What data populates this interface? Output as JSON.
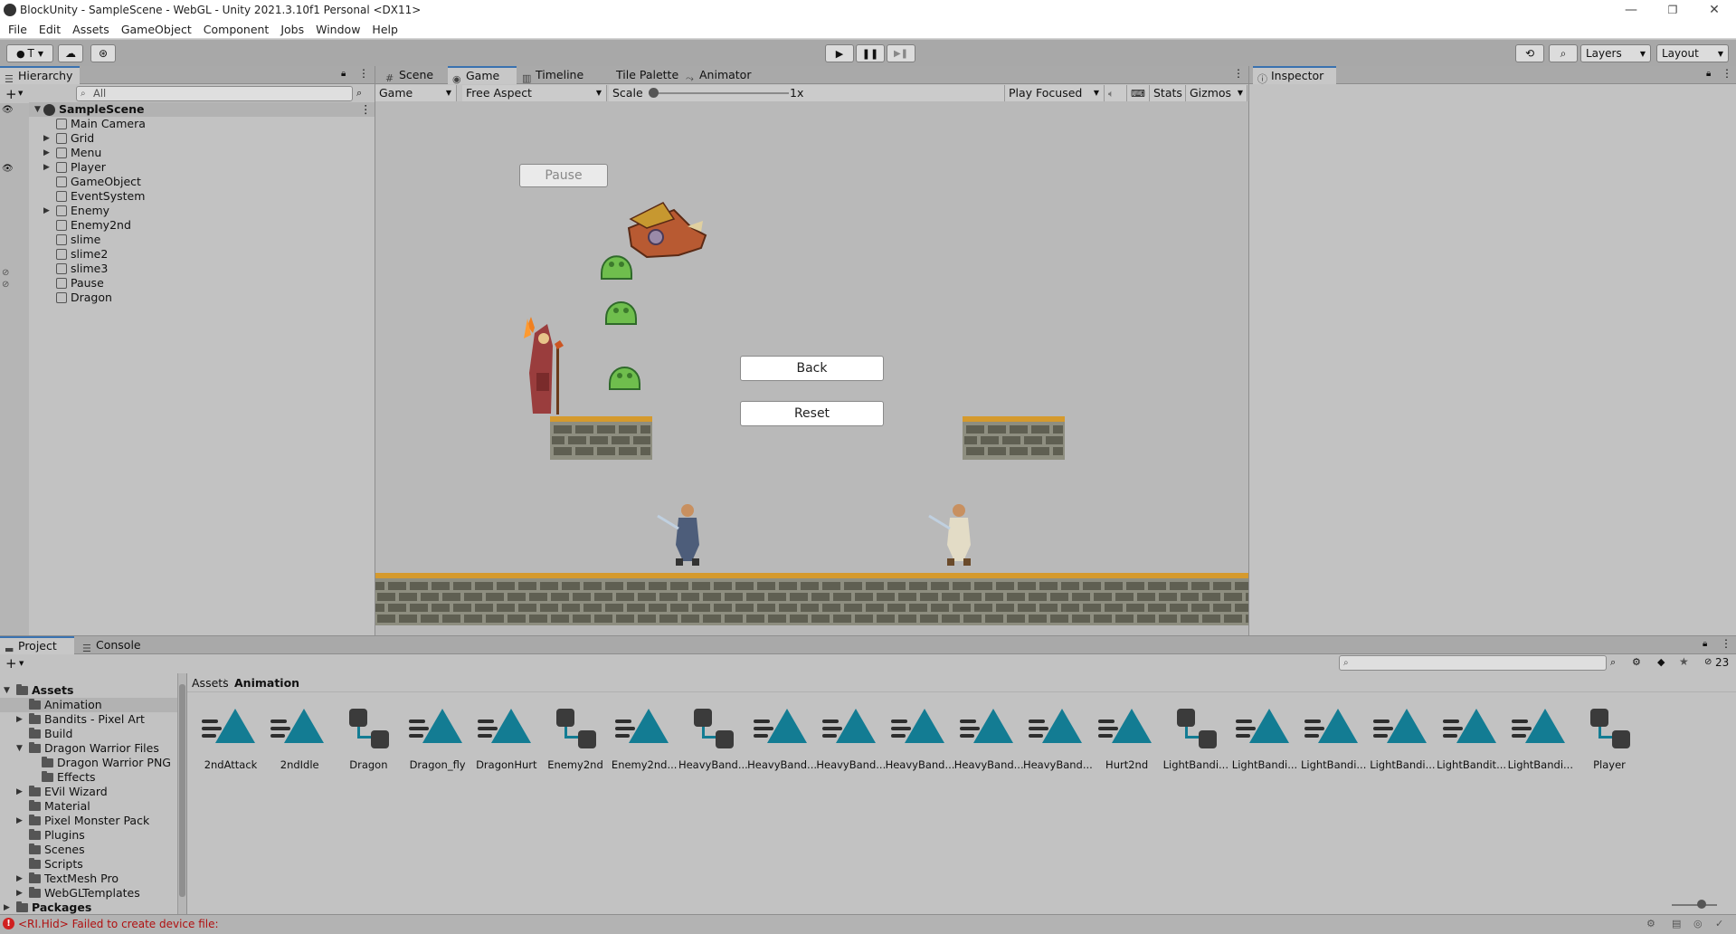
{
  "window": {
    "title": "BlockUnity - SampleScene - WebGL - Unity 2021.3.10f1 Personal <DX11>",
    "controls": [
      "—",
      "❐",
      "✕"
    ]
  },
  "menu": [
    "File",
    "Edit",
    "Assets",
    "GameObject",
    "Component",
    "Jobs",
    "Window",
    "Help"
  ],
  "toolbar": {
    "account_label": "T",
    "layers_label": "Layers",
    "layout_label": "Layout"
  },
  "hierarchy": {
    "tab_label": "Hierarchy",
    "search_placeholder": "All",
    "scene_name": "SampleScene",
    "items": [
      {
        "name": "Main Camera",
        "expandable": false
      },
      {
        "name": "Grid",
        "expandable": true
      },
      {
        "name": "Menu",
        "expandable": true
      },
      {
        "name": "Player",
        "expandable": true
      },
      {
        "name": "GameObject",
        "expandable": false
      },
      {
        "name": "EventSystem",
        "expandable": false
      },
      {
        "name": "Enemy",
        "expandable": true
      },
      {
        "name": "Enemy2nd",
        "expandable": false
      },
      {
        "name": "slime",
        "expandable": false
      },
      {
        "name": "slime2",
        "expandable": false
      },
      {
        "name": "slime3",
        "expandable": false
      },
      {
        "name": "Pause",
        "expandable": false
      },
      {
        "name": "Dragon",
        "expandable": false
      }
    ]
  },
  "center_tabs": [
    "Scene",
    "Game",
    "Timeline",
    "Tile Palette",
    "Animator"
  ],
  "game_toolbar": {
    "display": "Game",
    "aspect": "Free Aspect",
    "scale_label": "Scale",
    "scale_value": "1x",
    "play_mode": "Play Focused",
    "stats": "Stats",
    "gizmos": "Gizmos"
  },
  "game_view": {
    "pause_button": "Pause",
    "back_button": "Back",
    "reset_button": "Reset"
  },
  "inspector": {
    "tab_label": "Inspector"
  },
  "bottom_tabs": [
    "Project",
    "Console"
  ],
  "project": {
    "hidden_count": "23",
    "breadcrumb": [
      "Assets",
      "Animation"
    ],
    "tree": [
      {
        "name": "Assets",
        "level": 0,
        "expanded": true,
        "bold": true
      },
      {
        "name": "Animation",
        "level": 1,
        "selected": true
      },
      {
        "name": "Bandits - Pixel Art",
        "level": 1,
        "expandable": true
      },
      {
        "name": "Build",
        "level": 1
      },
      {
        "name": "Dragon Warrior Files",
        "level": 1,
        "expanded": true
      },
      {
        "name": "Dragon Warrior PNG",
        "level": 2
      },
      {
        "name": "Effects",
        "level": 2
      },
      {
        "name": "EVil Wizard",
        "level": 1,
        "expandable": true
      },
      {
        "name": "Material",
        "level": 1
      },
      {
        "name": "Pixel Monster Pack",
        "level": 1,
        "expandable": true
      },
      {
        "name": "Plugins",
        "level": 1
      },
      {
        "name": "Scenes",
        "level": 1
      },
      {
        "name": "Scripts",
        "level": 1
      },
      {
        "name": "TextMesh Pro",
        "level": 1,
        "expandable": true
      },
      {
        "name": "WebGLTemplates",
        "level": 1,
        "expandable": true
      },
      {
        "name": "Packages",
        "level": 0,
        "bold": true,
        "expandable": true
      }
    ],
    "assets": [
      {
        "name": "2ndAttack",
        "kind": "anim"
      },
      {
        "name": "2ndIdle",
        "kind": "anim"
      },
      {
        "name": "Dragon",
        "kind": "controller"
      },
      {
        "name": "Dragon_fly",
        "kind": "anim"
      },
      {
        "name": "DragonHurt",
        "kind": "anim"
      },
      {
        "name": "Enemy2nd",
        "kind": "controller"
      },
      {
        "name": "Enemy2nd...",
        "kind": "anim"
      },
      {
        "name": "HeavyBand...",
        "kind": "controller"
      },
      {
        "name": "HeavyBand...",
        "kind": "anim"
      },
      {
        "name": "HeavyBand...",
        "kind": "anim"
      },
      {
        "name": "HeavyBand...",
        "kind": "anim"
      },
      {
        "name": "HeavyBand...",
        "kind": "anim"
      },
      {
        "name": "HeavyBand...",
        "kind": "anim"
      },
      {
        "name": "Hurt2nd",
        "kind": "anim"
      },
      {
        "name": "LightBandi...",
        "kind": "controller"
      },
      {
        "name": "LightBandi...",
        "kind": "anim"
      },
      {
        "name": "LightBandi...",
        "kind": "anim"
      },
      {
        "name": "LightBandi...",
        "kind": "anim"
      },
      {
        "name": "LightBandit...",
        "kind": "anim"
      },
      {
        "name": "LightBandi...",
        "kind": "anim"
      },
      {
        "name": "Player",
        "kind": "controller"
      }
    ]
  },
  "status": {
    "message": "<RI.Hid> Failed to create device file:"
  },
  "colors": {
    "accent": "#3a72b0",
    "anim_icon": "#137c93",
    "error": "#d02020"
  }
}
